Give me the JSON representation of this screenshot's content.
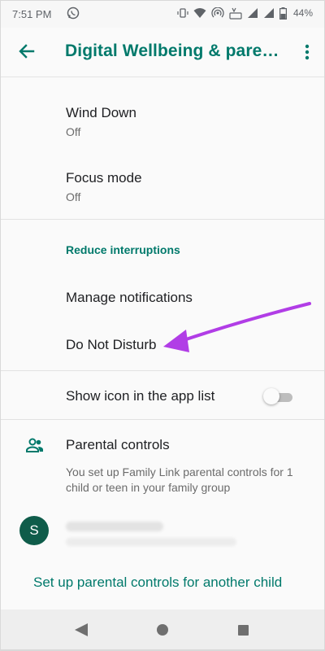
{
  "status_bar": {
    "time": "7:51 PM",
    "battery": "44%",
    "icons": [
      "whatsapp-icon",
      "vibrate-icon",
      "wifi-icon",
      "hotspot-icon",
      "volte-icon",
      "signal-icon",
      "signal-icon",
      "battery-icon"
    ]
  },
  "app_bar": {
    "title": "Digital Wellbeing & parental controls",
    "back_icon": "arrow-back-icon",
    "menu_icon": "more-vert-icon"
  },
  "items": {
    "wind_down": {
      "title": "Wind Down",
      "subtitle": "Off"
    },
    "focus_mode": {
      "title": "Focus mode",
      "subtitle": "Off"
    }
  },
  "reduce_interruptions": {
    "header": "Reduce interruptions",
    "manage_notifications": "Manage notifications",
    "do_not_disturb": "Do Not Disturb"
  },
  "show_icon": {
    "label": "Show icon in the app list",
    "enabled": false
  },
  "parental": {
    "title": "Parental controls",
    "description": "You set up Family Link parental controls for 1 child or teen in your family group",
    "child_avatar_letter": "S",
    "setup_link": "Set up parental controls for another child"
  },
  "annotation": {
    "arrow_color": "#b13de6"
  },
  "colors": {
    "accent": "#00796b",
    "avatar": "#0f5c4a"
  }
}
